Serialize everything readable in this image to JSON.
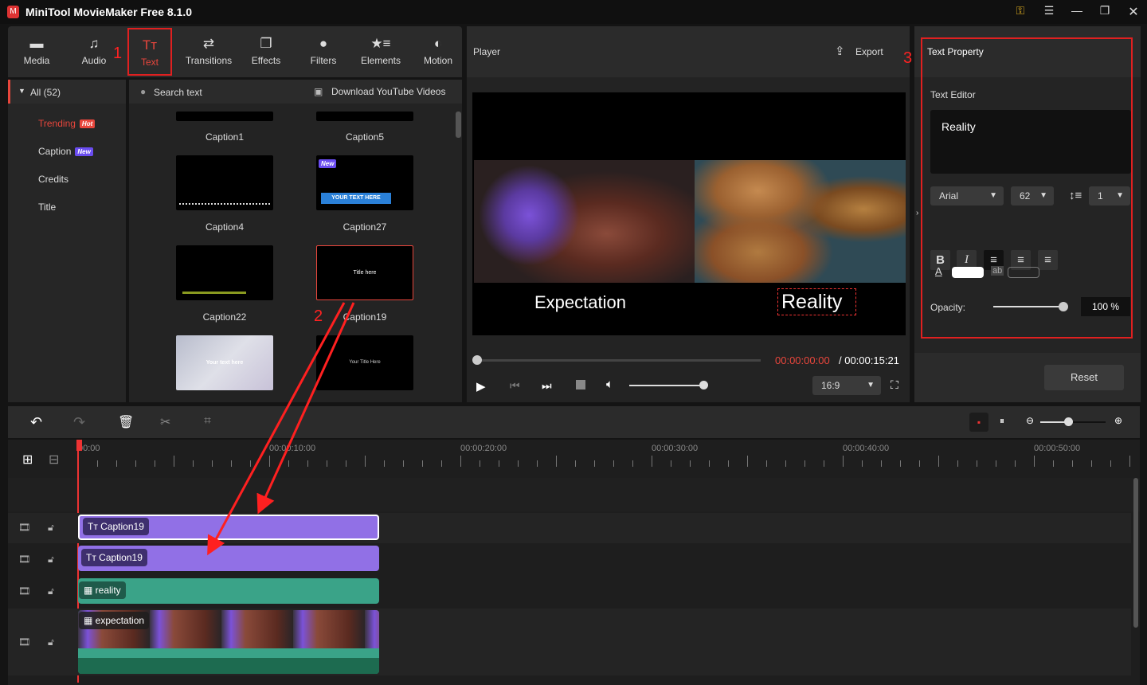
{
  "app": {
    "title": "MiniTool MovieMaker Free 8.1.0"
  },
  "window_controls": [
    "key-icon",
    "menu-icon",
    "minimize-icon",
    "maximize-icon",
    "close-icon"
  ],
  "toolbar": {
    "tabs": [
      {
        "label": "Media",
        "icon": "folder-icon"
      },
      {
        "label": "Audio",
        "icon": "music-icon"
      },
      {
        "label": "Text",
        "icon": "text-icon",
        "active": true
      },
      {
        "label": "Transitions",
        "icon": "transitions-icon"
      },
      {
        "label": "Effects",
        "icon": "effects-icon"
      },
      {
        "label": "Filters",
        "icon": "filters-icon"
      },
      {
        "label": "Elements",
        "icon": "elements-icon"
      },
      {
        "label": "Motion",
        "icon": "motion-icon"
      }
    ]
  },
  "categories": {
    "all": "All (52)",
    "items": [
      {
        "label": "Trending",
        "badge": "Hot"
      },
      {
        "label": "Caption",
        "badge": "New"
      },
      {
        "label": "Credits"
      },
      {
        "label": "Title"
      }
    ]
  },
  "library": {
    "search_placeholder": "Search text",
    "download": "Download YouTube Videos",
    "items": [
      {
        "label": "Caption1"
      },
      {
        "label": "Caption5"
      },
      {
        "label": "Caption4"
      },
      {
        "label": "Caption27",
        "badge": "New",
        "thumb_text": "YOUR TEXT HERE"
      },
      {
        "label": "Caption22"
      },
      {
        "label": "Caption19",
        "thumb_text": "Title here"
      },
      {
        "thumb_text": "Your text here"
      },
      {
        "thumb_text": "Your  Title Here"
      }
    ]
  },
  "player": {
    "title": "Player",
    "export": "Export",
    "caption_left": "Expectation",
    "caption_right": "Reality",
    "current_time": "00:00:00:00",
    "total_time": "/ 00:00:15:21",
    "aspect": "16:9",
    "volume": 100,
    "progress": 0
  },
  "text_property": {
    "title": "Text Property",
    "editor_label": "Text Editor",
    "text": "Reality",
    "font": "Arial",
    "size": "62",
    "line_spacing": "1",
    "opacity_label": "Opacity:",
    "opacity": "100 %",
    "opacity_value": 100,
    "text_color": "#ffffff",
    "reset": "Reset"
  },
  "timeline": {
    "ruler": [
      "00:00",
      "00:00:10:00",
      "00:00:20:00",
      "00:00:30:00",
      "00:00:40:00",
      "00:00:50:00"
    ],
    "tracks": [
      {
        "label": "Caption19",
        "type": "text",
        "color": "#9170e6"
      },
      {
        "label": "Caption19",
        "type": "text",
        "color": "#9170e6"
      },
      {
        "label": "reality",
        "type": "video",
        "color": "#3aa388"
      },
      {
        "label": "expectation",
        "type": "video",
        "color": "#3aa388"
      }
    ]
  },
  "annotations": [
    "1",
    "2",
    "3"
  ],
  "colors": {
    "accent": "#e8463c",
    "text_clip": "#9170e6",
    "video_clip": "#3aa388",
    "annotation": "#ff2020"
  }
}
